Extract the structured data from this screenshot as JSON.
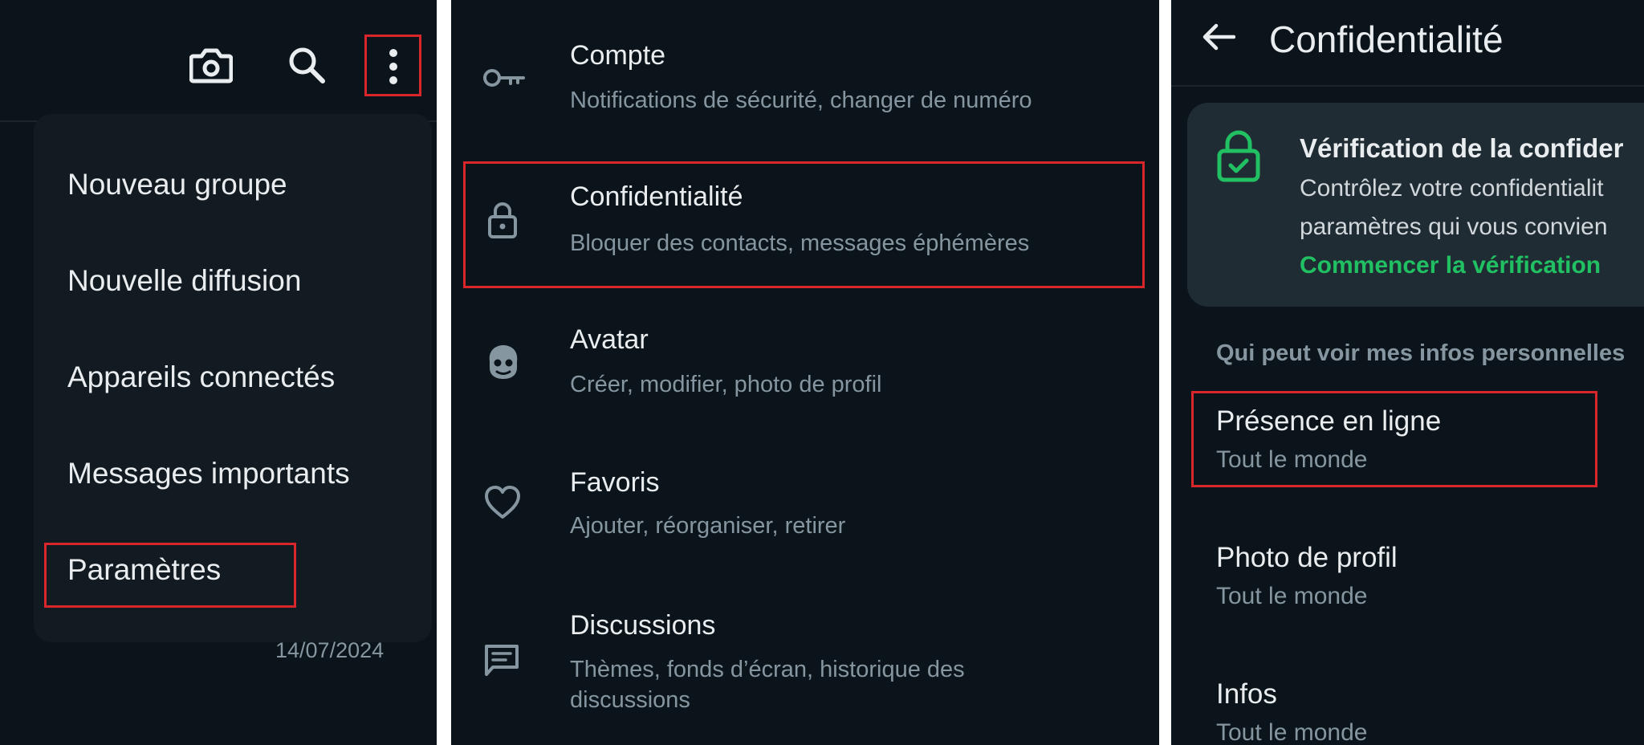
{
  "overflow_menu": {
    "toolbar_icons": [
      "camera-icon",
      "search-icon",
      "more-vert-icon"
    ],
    "items": [
      {
        "label": "Nouveau groupe"
      },
      {
        "label": "Nouvelle diffusion"
      },
      {
        "label": "Appareils connectés"
      },
      {
        "label": "Messages importants"
      },
      {
        "label": "Paramètres"
      }
    ],
    "background_date": "14/07/2024"
  },
  "settings": {
    "items": [
      {
        "icon": "key-icon",
        "title": "Compte",
        "subtitle": "Notifications de sécurité, changer de numéro"
      },
      {
        "icon": "lock-icon",
        "title": "Confidentialité",
        "subtitle": "Bloquer des contacts, messages éphémères"
      },
      {
        "icon": "avatar-icon",
        "title": "Avatar",
        "subtitle": "Créer, modifier, photo de profil"
      },
      {
        "icon": "heart-icon",
        "title": "Favoris",
        "subtitle": "Ajouter, réorganiser, retirer"
      },
      {
        "icon": "chat-icon",
        "title": "Discussions",
        "subtitle_line1": "Thèmes, fonds d’écran, historique des",
        "subtitle_line2": "discussions"
      }
    ]
  },
  "privacy": {
    "back_icon": "arrow-left-icon",
    "title": "Confidentialité",
    "checkup": {
      "icon": "shield-lock-check-icon",
      "title": "Vérification de la confider",
      "line1": "Contrôlez votre confidentialit",
      "line2": "paramètres qui vous convien",
      "link": "Commencer la vérification"
    },
    "section_header": "Qui peut voir mes infos personnelles",
    "items": [
      {
        "title": "Présence en ligne",
        "value": "Tout le monde"
      },
      {
        "title": "Photo de profil",
        "value": "Tout le monde"
      },
      {
        "title": "Infos",
        "value": "Tout le monde"
      }
    ]
  },
  "colors": {
    "background": "#0b141a",
    "menu_surface": "#111b21",
    "card_surface": "#1f2c33",
    "primary_text": "#e9edef",
    "secondary_text": "#8696a0",
    "accent_green": "#21c063",
    "highlight_red": "#d9262b"
  }
}
